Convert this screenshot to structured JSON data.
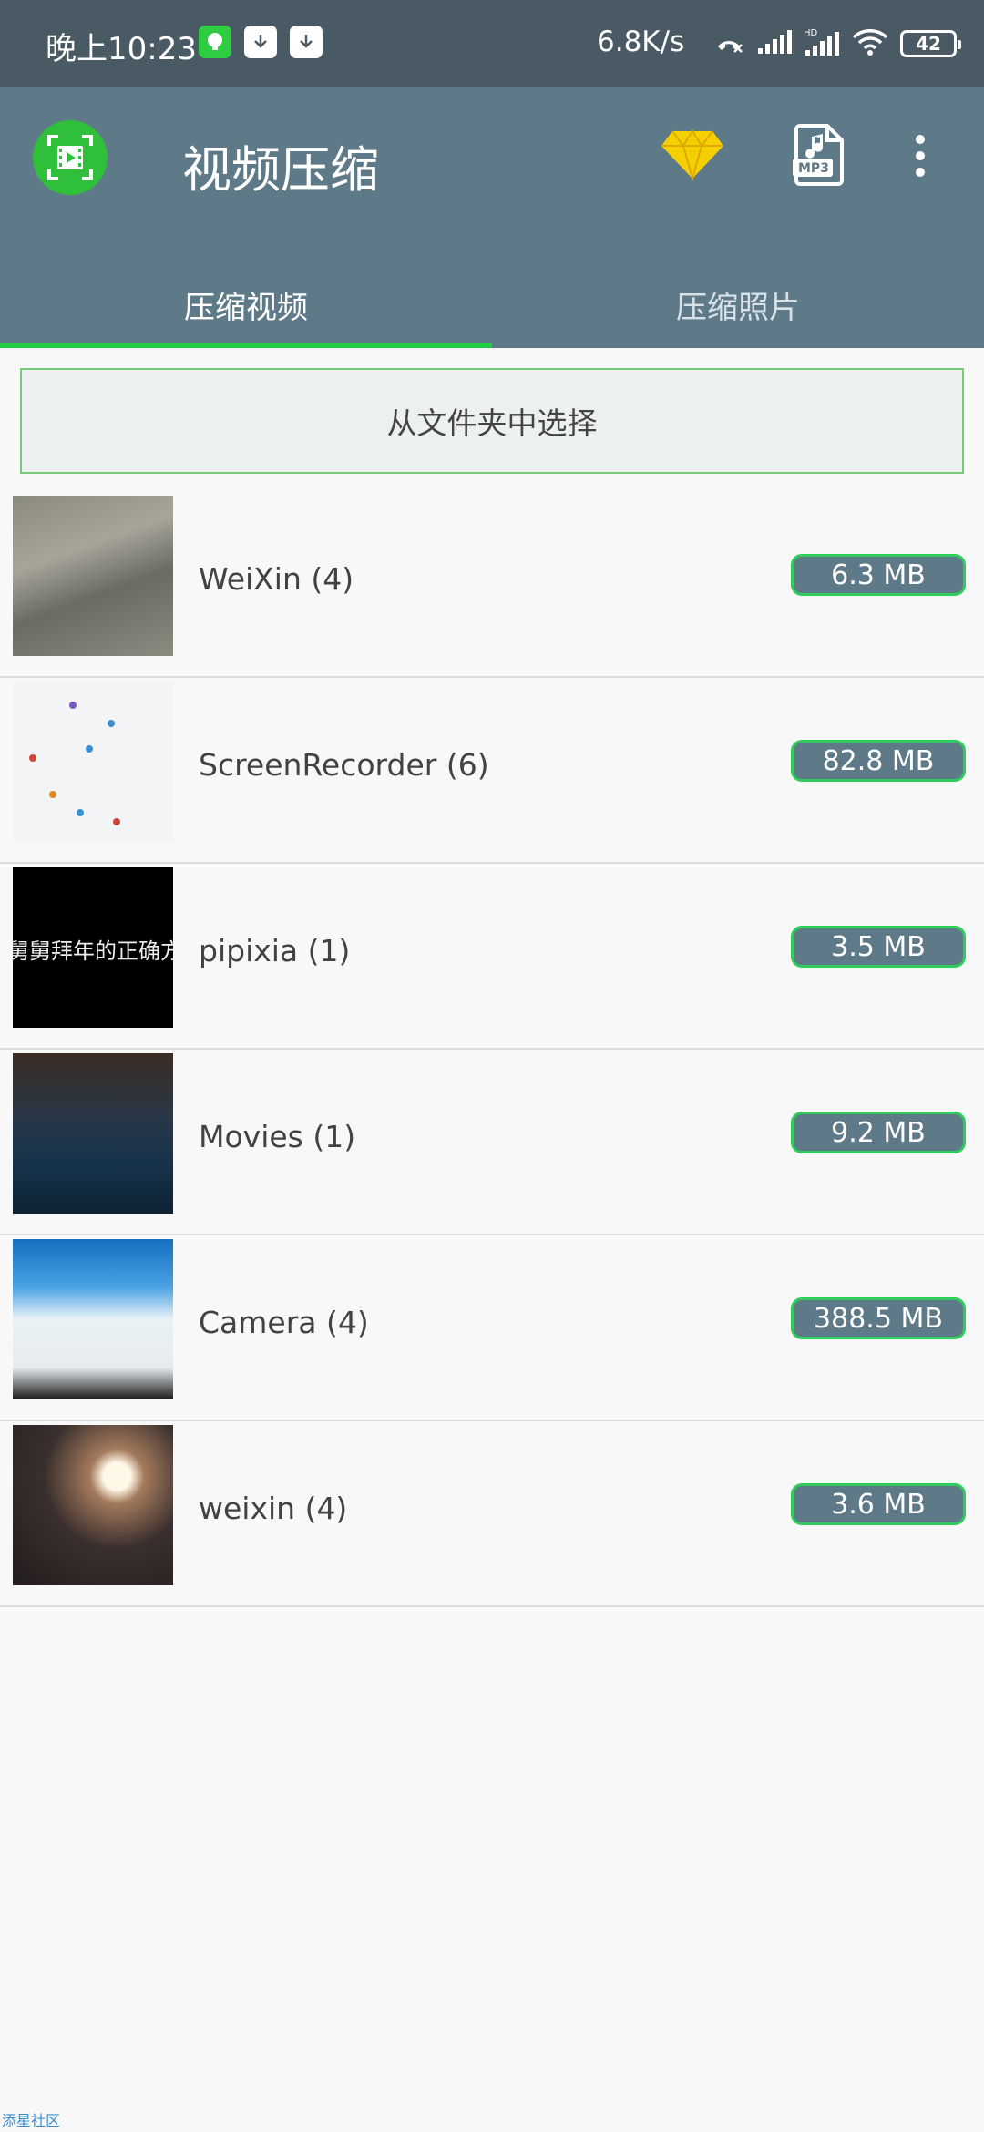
{
  "status_bar": {
    "time": "晚上10:23",
    "net_speed": "6.8K/s",
    "battery": "42",
    "icons": [
      "chat-app-icon",
      "download-icon",
      "download-icon",
      "call-off-icon",
      "signal-icon",
      "hd-signal-icon",
      "wifi-icon",
      "battery-icon"
    ]
  },
  "app_bar": {
    "title": "视频压缩",
    "icons": [
      "app-logo-icon",
      "diamond-icon",
      "mp3-file-icon",
      "more-vert-icon"
    ]
  },
  "tabs": [
    {
      "label": "压缩视频",
      "active": true
    },
    {
      "label": "压缩照片",
      "active": false
    }
  ],
  "choose_folder": {
    "label": "从文件夹中选择"
  },
  "folders": [
    {
      "name": "WeiXin (4)",
      "size": "6.3 MB"
    },
    {
      "name": "ScreenRecorder (6)",
      "size": "82.8 MB"
    },
    {
      "name": "pipixia (1)",
      "size": "3.5 MB"
    },
    {
      "name": "Movies (1)",
      "size": "9.2 MB"
    },
    {
      "name": "Camera (4)",
      "size": "388.5 MB"
    },
    {
      "name": "weixin (4)",
      "size": "3.6 MB"
    }
  ],
  "thumbnail_text": {
    "pipixia": "舅舅拜年的正确方"
  },
  "watermark": "添星社区",
  "colors": {
    "status_bar": "#4a5a65",
    "app_bar": "#5e7a88",
    "accent_green": "#22cc44",
    "badge_bg": "#5e7a88",
    "background": "#f8f8f8"
  }
}
